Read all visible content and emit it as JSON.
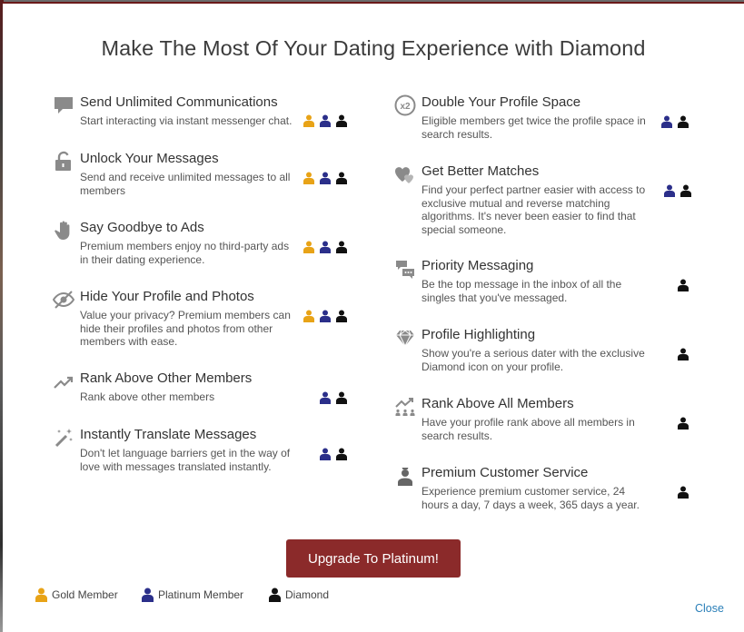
{
  "title": "Make The Most Of Your Dating Experience with Diamond",
  "colors": {
    "gold": "#e8a317",
    "platinum": "#2b2f8a",
    "diamond": "#111111",
    "icon": "#8a8a8a",
    "button": "#8b2a2a",
    "link": "#2a7fb8"
  },
  "features_left": [
    {
      "icon": "chat-bubble-icon",
      "title": "Send Unlimited Communications",
      "desc": "Start interacting via instant messenger chat.",
      "tiers": [
        "gold",
        "platinum",
        "diamond"
      ]
    },
    {
      "icon": "unlock-icon",
      "title": "Unlock Your Messages",
      "desc": "Send and receive unlimited messages to all members",
      "tiers": [
        "gold",
        "platinum",
        "diamond"
      ]
    },
    {
      "icon": "hand-icon",
      "title": "Say Goodbye to Ads",
      "desc": "Premium members enjoy no third-party ads in their dating experience.",
      "tiers": [
        "gold",
        "platinum",
        "diamond"
      ]
    },
    {
      "icon": "hidden-eye-icon",
      "title": "Hide Your Profile and Photos",
      "desc": "Value your privacy? Premium members can hide their profiles and photos from other members with ease.",
      "tiers": [
        "gold",
        "platinum",
        "diamond"
      ]
    },
    {
      "icon": "trending-up-icon",
      "title": "Rank Above Other Members",
      "desc": "Rank above other members",
      "tiers": [
        "platinum",
        "diamond"
      ]
    },
    {
      "icon": "magic-wand-icon",
      "title": "Instantly Translate Messages",
      "desc": "Don't let language barriers get in the way of love with messages translated instantly.",
      "tiers": [
        "platinum",
        "diamond"
      ]
    }
  ],
  "features_right": [
    {
      "icon": "x2-icon",
      "title": "Double Your Profile Space",
      "desc": "Eligible members get twice the profile space in search results.",
      "tiers": [
        "platinum",
        "diamond"
      ]
    },
    {
      "icon": "hearts-icon",
      "title": "Get Better Matches",
      "desc": "Find your perfect partner easier with access to exclusive mutual and reverse matching algorithms. It's never been easier to find that special someone.",
      "tiers": [
        "platinum",
        "diamond"
      ]
    },
    {
      "icon": "priority-message-icon",
      "title": "Priority Messaging",
      "desc": "Be the top message in the inbox of all the singles that you've messaged.",
      "tiers": [
        "diamond"
      ]
    },
    {
      "icon": "diamond-icon",
      "title": "Profile Highlighting",
      "desc": "Show you're a serious dater with the exclusive Diamond icon on your profile.",
      "tiers": [
        "diamond"
      ]
    },
    {
      "icon": "rank-people-icon",
      "title": "Rank Above All Members",
      "desc": "Have your profile rank above all members in search results.",
      "tiers": [
        "diamond"
      ]
    },
    {
      "icon": "customer-service-icon",
      "title": "Premium Customer Service",
      "desc": "Experience premium customer service, 24 hours a day, 7 days a week, 365 days a year.",
      "tiers": [
        "diamond"
      ]
    }
  ],
  "upgrade_button": "Upgrade To Platinum!",
  "legend": [
    {
      "tier": "gold",
      "label": "Gold Member"
    },
    {
      "tier": "platinum",
      "label": "Platinum Member"
    },
    {
      "tier": "diamond",
      "label": "Diamond"
    }
  ],
  "close_label": "Close"
}
